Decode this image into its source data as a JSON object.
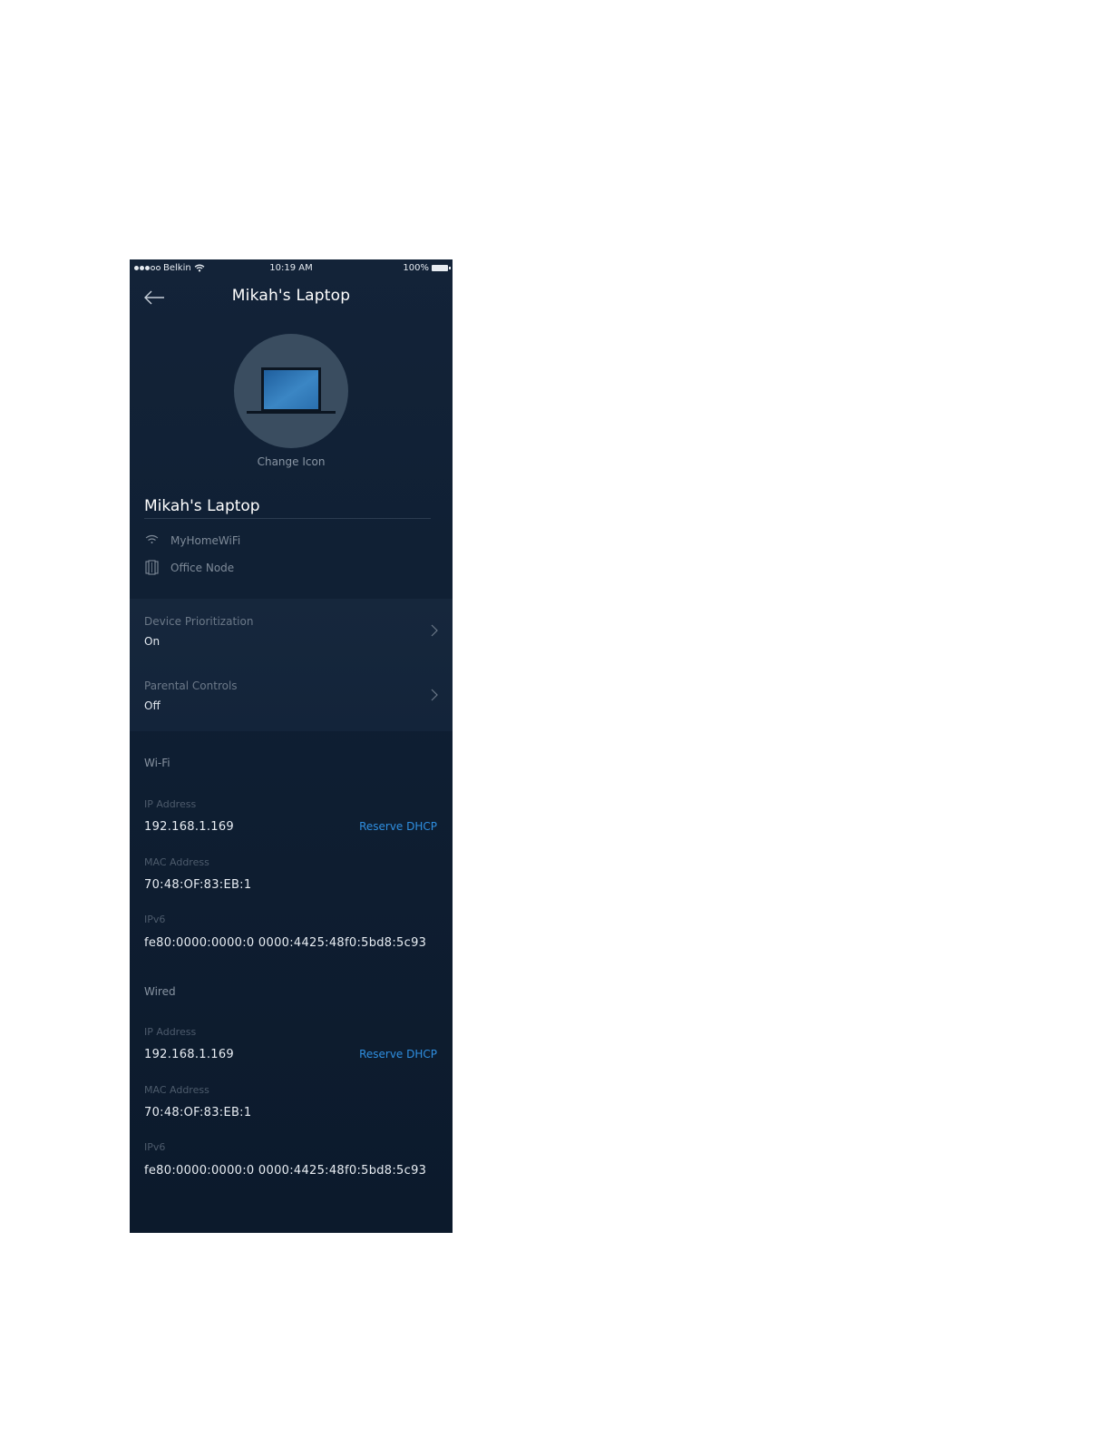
{
  "status_bar": {
    "carrier": "Belkin",
    "time": "10:19 AM",
    "battery": "100%"
  },
  "header": {
    "title": "Mikah's Laptop"
  },
  "device": {
    "change_icon_label": "Change Icon",
    "name": "Mikah's Laptop",
    "network": "MyHomeWiFi",
    "node": "Office Node"
  },
  "settings": [
    {
      "label": "Device Prioritization",
      "value": "On"
    },
    {
      "label": "Parental Controls",
      "value": "Off"
    }
  ],
  "wifi": {
    "title": "Wi-Fi",
    "ip_label": "IP Address",
    "ip_value": "192.168.1.169",
    "reserve_label": "Reserve DHCP",
    "mac_label": "MAC Address",
    "mac_value": "70:48:OF:83:EB:1",
    "ipv6_label": "IPv6",
    "ipv6_value": "fe80:0000:0000:0 0000:4425:48f0:5bd8:5c93"
  },
  "wired": {
    "title": "Wired",
    "ip_label": "IP Address",
    "ip_value": "192.168.1.169",
    "reserve_label": "Reserve DHCP",
    "mac_label": "MAC Address",
    "mac_value": "70:48:OF:83:EB:1",
    "ipv6_label": "IPv6",
    "ipv6_value": "fe80:0000:0000:0 0000:4425:48f0:5bd8:5c93"
  },
  "colors": {
    "background": "#0f1f33",
    "accent": "#2f8fe0",
    "icon_circle": "#3a4d60"
  }
}
